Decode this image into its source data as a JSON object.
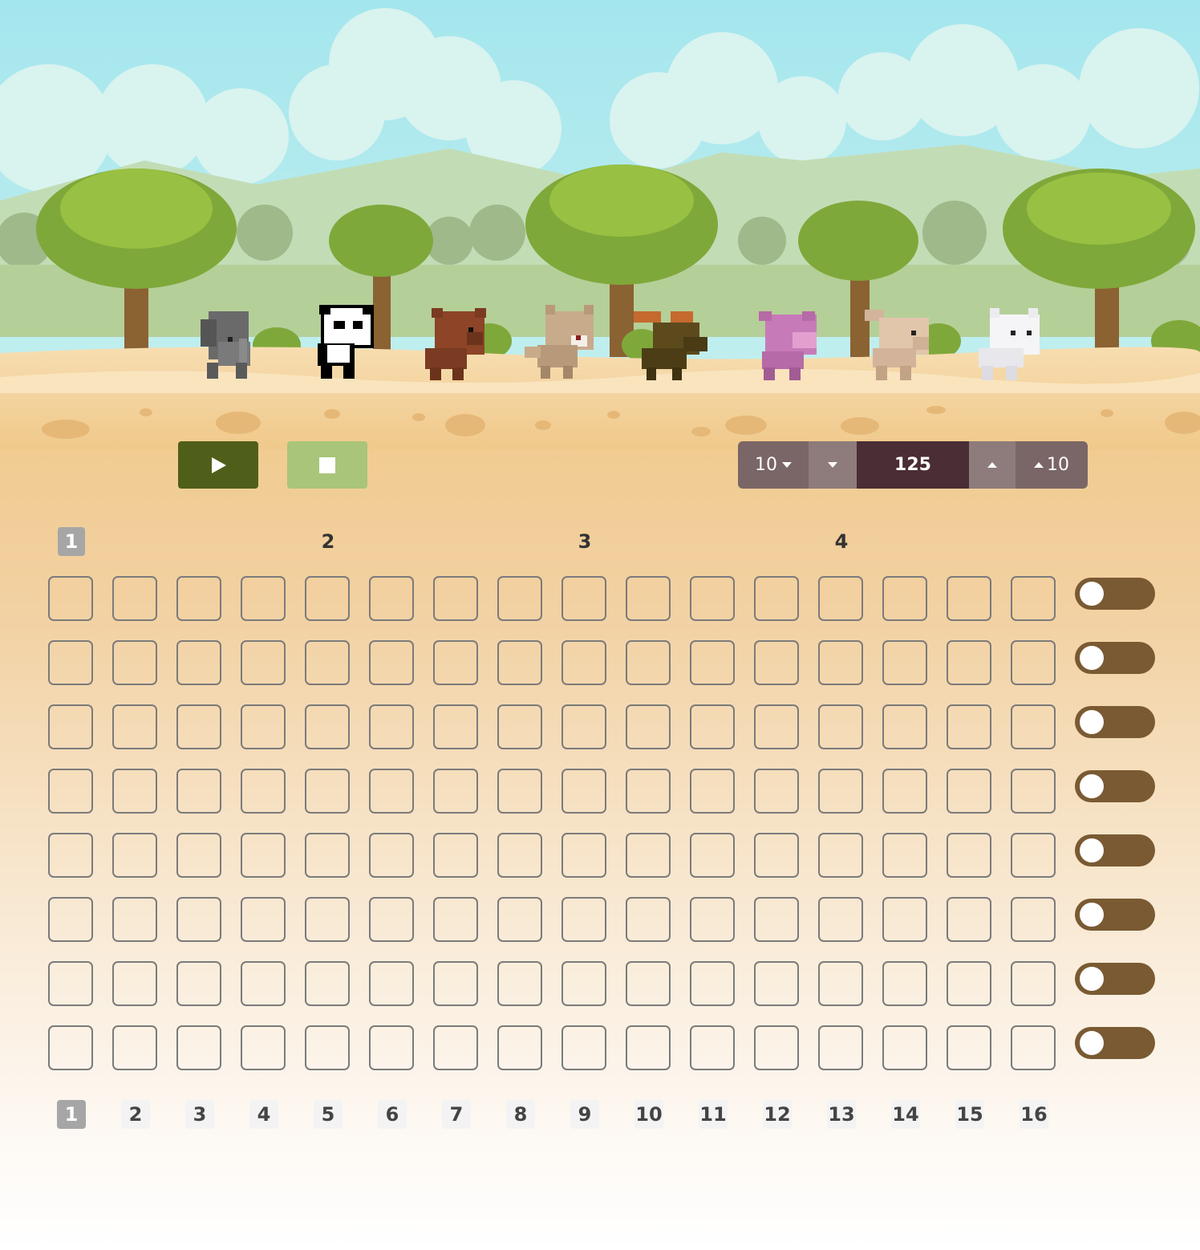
{
  "controls": {
    "play_icon": "play-icon",
    "stop_icon": "stop-icon"
  },
  "tempo": {
    "decrease_10_label": "10",
    "value": "125",
    "increase_10_label": "10"
  },
  "bars": [
    "1",
    "2",
    "3",
    "4"
  ],
  "active_bar": 0,
  "steps": [
    "1",
    "2",
    "3",
    "4",
    "5",
    "6",
    "7",
    "8",
    "9",
    "10",
    "11",
    "12",
    "13",
    "14",
    "15",
    "16"
  ],
  "active_step": 0,
  "animals": [
    "elephant",
    "panda",
    "bear",
    "cat",
    "moose",
    "pig",
    "rabbit",
    "white-cat"
  ],
  "rows": 8,
  "colors": {
    "play": "#4f5f1a",
    "stop": "#a9c57a",
    "tempo_dark": "#4a2d35",
    "toggle": "#7a5a32"
  }
}
